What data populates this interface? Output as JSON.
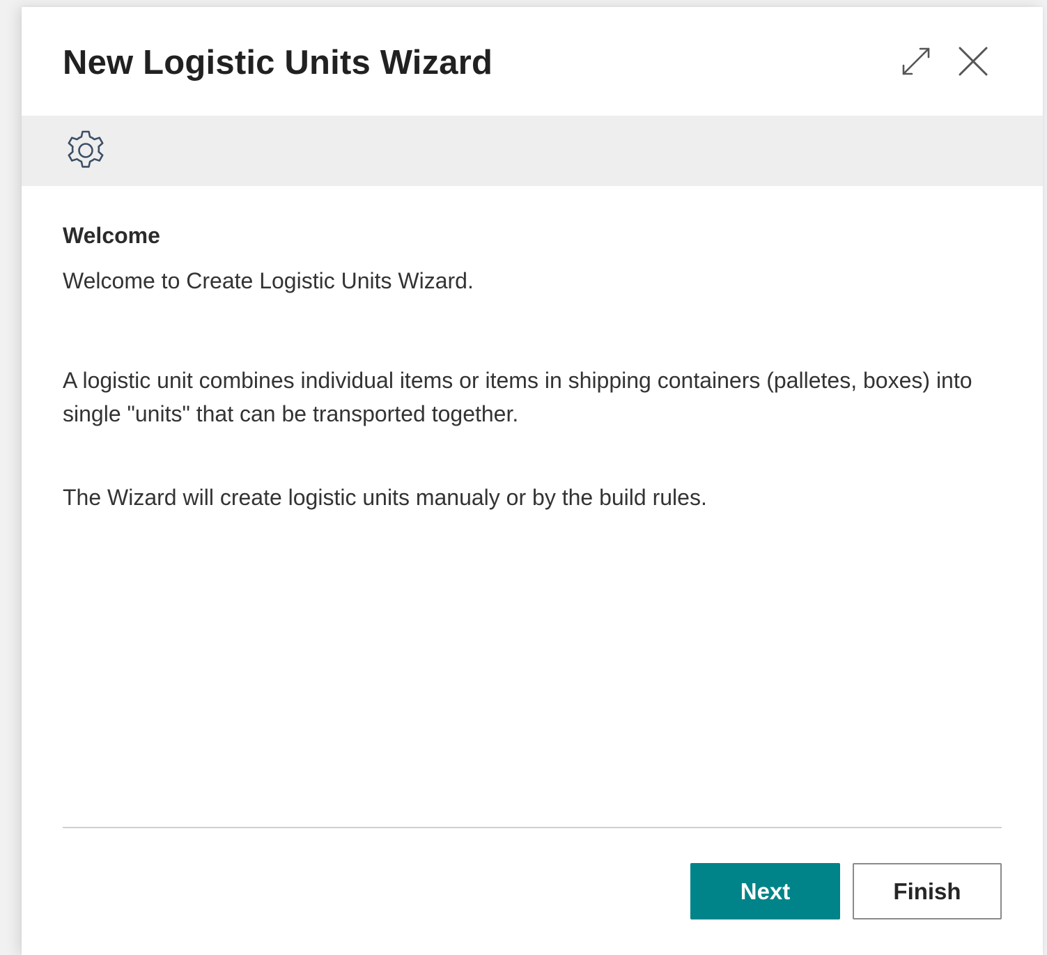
{
  "dialog": {
    "title": "New Logistic Units Wizard",
    "icons": {
      "expand": "expand-icon",
      "close": "close-icon",
      "banner": "gear-icon"
    }
  },
  "content": {
    "section_title": "Welcome",
    "paragraphs": [
      "Welcome to Create Logistic Units Wizard.",
      "A logistic unit combines individual items or items in shipping containers (palletes, boxes) into single \"units\" that can be transported together.",
      "The Wizard will create logistic units manualy or by the build rules."
    ]
  },
  "footer": {
    "next_label": "Next",
    "finish_label": "Finish"
  },
  "colors": {
    "accent": "#008489",
    "banner_bg": "#eeeeee"
  }
}
